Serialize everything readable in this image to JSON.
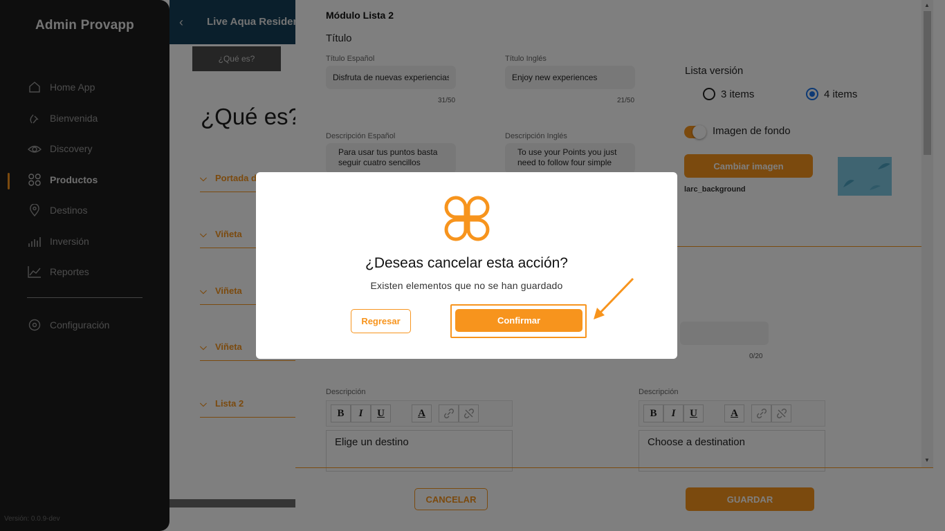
{
  "app": {
    "brand": "Admin Provapp",
    "version": "Versión: 0.0.9-dev"
  },
  "sidebar": {
    "items": [
      {
        "label": "Home App",
        "icon": "home-icon"
      },
      {
        "label": "Bienvenida",
        "icon": "hand-wave-icon"
      },
      {
        "label": "Discovery",
        "icon": "eye-icon"
      },
      {
        "label": "Productos",
        "icon": "grid-icon",
        "active": true
      },
      {
        "label": "Destinos",
        "icon": "map-pin-icon"
      },
      {
        "label": "Inversión",
        "icon": "bar-chart-icon"
      },
      {
        "label": "Reportes",
        "icon": "trend-chart-icon"
      }
    ],
    "settings": {
      "label": "Configuración",
      "icon": "gear-icon"
    }
  },
  "page": {
    "header_title": "Live Aqua Residence",
    "subtab": "¿Qué es?",
    "heading": "¿Qué es?",
    "accordions": [
      "Portada de",
      "Viñeta",
      "Viñeta",
      "Viñeta",
      "Lista 2"
    ]
  },
  "panel": {
    "module_title": "Módulo Lista 2",
    "section_title": "Título",
    "title_es": {
      "label": "Título Español",
      "value": "Disfruta de nuevas experiencias",
      "count": "31/50"
    },
    "title_en": {
      "label": "Título Inglés",
      "value": "Enjoy new experiences",
      "count": "21/50"
    },
    "desc_es": {
      "label": "Descripción Español",
      "value": "Para usar tus puntos basta seguir cuatro sencillos"
    },
    "desc_en": {
      "label": "Descripción Inglés",
      "value": "To use your Points you just need to follow four simple"
    },
    "list_version": {
      "label": "Lista versión",
      "options": [
        "3 items",
        "4 items"
      ],
      "selected": "4 items"
    },
    "bg_image": {
      "toggle_label": "Imagen de fondo",
      "enabled": true,
      "change_button": "Cambiar imagen",
      "file_name": "larc_background"
    },
    "second_count": "0/20",
    "editor_es": {
      "label": "Descripción",
      "content": "Elige un destino"
    },
    "editor_en": {
      "label": "Descripción",
      "content": "Choose a destination"
    },
    "toolbar": {
      "bold": "B",
      "italic": "I",
      "underline": "U",
      "color": "A"
    },
    "cancel_button": "CANCELAR",
    "save_button": "GUARDAR"
  },
  "modal": {
    "title": "¿Deseas cancelar esta acción?",
    "subtitle": "Existen elementos que no se han guardado",
    "back_button": "Regresar",
    "confirm_button": "Confirmar"
  },
  "colors": {
    "accent": "#f7941d",
    "sidebar": "#1c1c1c",
    "radio_selected": "#1a73e8"
  }
}
